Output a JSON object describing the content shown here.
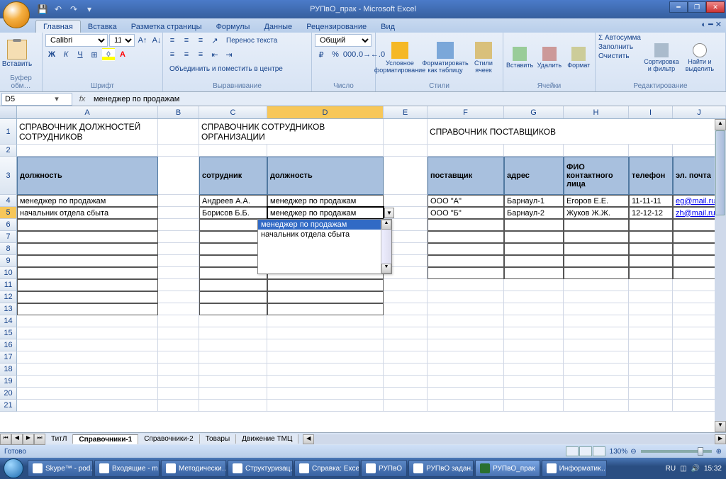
{
  "title": "РУПвО_прак - Microsoft Excel",
  "ribbon_tabs": [
    "Главная",
    "Вставка",
    "Разметка страницы",
    "Формулы",
    "Данные",
    "Рецензирование",
    "Вид"
  ],
  "active_ribbon_tab": 0,
  "ribbon": {
    "clipboard": {
      "paste": "Вставить",
      "label": "Буфер обм…"
    },
    "font": {
      "name": "Calibri",
      "size": "11",
      "label": "Шрифт"
    },
    "alignment": {
      "wrap": "Перенос текста",
      "merge": "Объединить и поместить в центре",
      "label": "Выравнивание"
    },
    "number": {
      "format": "Общий",
      "label": "Число"
    },
    "styles": {
      "cond": "Условное форматирование",
      "table": "Форматировать как таблицу",
      "cell": "Стили ячеек",
      "label": "Стили"
    },
    "cells": {
      "insert": "Вставить",
      "delete": "Удалить",
      "format": "Формат",
      "label": "Ячейки"
    },
    "editing": {
      "sum": "Σ Автосумма",
      "fill": "Заполнить",
      "clear": "Очистить",
      "sort": "Сортировка и фильтр",
      "find": "Найти и выделить",
      "label": "Редактирование"
    }
  },
  "name_box": "D5",
  "formula_value": "менеджер по продажам",
  "columns": [
    "A",
    "B",
    "C",
    "D",
    "E",
    "F",
    "G",
    "H",
    "I",
    "J"
  ],
  "row_numbers": [
    1,
    2,
    3,
    4,
    5,
    6,
    7,
    8,
    9,
    10,
    11,
    12,
    13,
    14,
    15,
    16,
    17,
    18,
    19,
    20,
    21
  ],
  "titles": {
    "t1": "СПРАВОЧНИК ДОЛЖНОСТЕЙ СОТРУДНИКОВ",
    "t2": "СПРАВОЧНИК СОТРУДНИКОВ ОРГАНИЗАЦИИ",
    "t3": "СПРАВОЧНИК ПОСТАВЩИКОВ"
  },
  "headers": {
    "h1": "должность",
    "h2": "сотрудник",
    "h3": "должность",
    "h4": "поставщик",
    "h5": "адрес",
    "h6": "ФИО контактного лица",
    "h7": "телефон",
    "h8": "эл. почта"
  },
  "data": {
    "a4": "менеджер по продажам",
    "a5": "начальник отдела сбыта",
    "c4": "Андреев А.А.",
    "c5": "Борисов Б.Б.",
    "d4": "менеджер по продажам",
    "d5": "менеджер по продажам",
    "f4": "ООО \"А\"",
    "f5": "ООО \"Б\"",
    "g4": "Барнаул-1",
    "g5": "Барнаул-2",
    "h4": "Егоров Е.Е.",
    "h5": "Жуков Ж.Ж.",
    "i4": "11-11-11",
    "i5": "12-12-12",
    "j4": "eg@mail.ru",
    "j5": "zh@mail.ru"
  },
  "dropdown": {
    "opt1": "менеджер по продажам",
    "opt2": "начальник отдела сбыта"
  },
  "sheets": [
    "ТитЛ",
    "Справочники-1",
    "Справочники-2",
    "Товары",
    "Движение ТМЦ"
  ],
  "active_sheet": 1,
  "status": {
    "ready": "Готово",
    "zoom": "130%"
  },
  "taskbar": [
    "Skype™ - pod…",
    "Входящие - m…",
    "Методически…",
    "Структуризац…",
    "Справка: Excel",
    "РУПвО",
    "РУПвО задан…",
    "РУПвО_прак",
    "Информатик…"
  ],
  "tray": {
    "lang": "RU",
    "time": "15:32"
  }
}
